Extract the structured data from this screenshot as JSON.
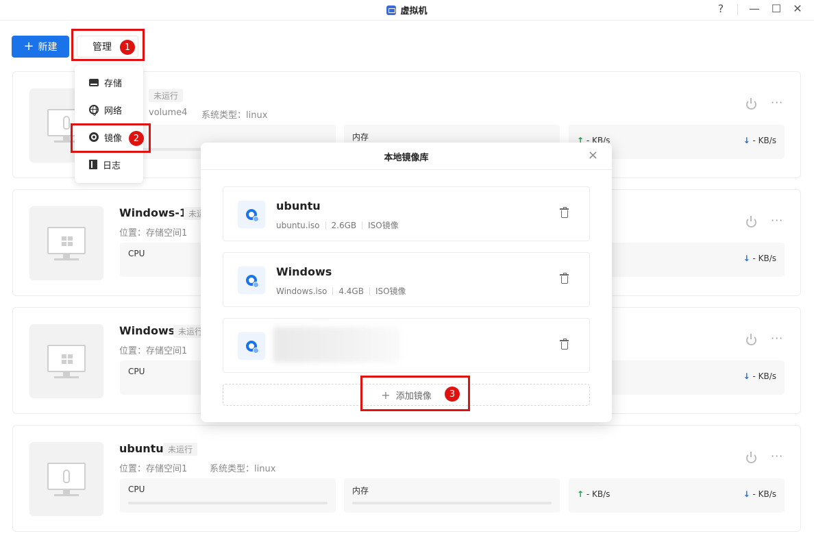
{
  "window": {
    "title": "虚拟机",
    "help": "?",
    "minimize": "—",
    "maximize": "☐",
    "close": "✕"
  },
  "toolbar": {
    "new_label": "新建",
    "manage_label": "管理"
  },
  "annotations": [
    "1",
    "2",
    "3"
  ],
  "manage_menu": {
    "items": [
      {
        "label": "存储",
        "icon": "storage-icon"
      },
      {
        "label": "网络",
        "icon": "globe-icon"
      },
      {
        "label": "镜像",
        "icon": "disc-icon"
      },
      {
        "label": "日志",
        "icon": "log-icon"
      }
    ]
  },
  "vms": [
    {
      "name": "",
      "status": "未运行",
      "location": "volume4",
      "os_type": "系统类型：linux",
      "cpu_label": "",
      "mem_label": "内存",
      "net_up": "- KB/s",
      "net_down": "- KB/s",
      "os": "linux"
    },
    {
      "name": "Windows-1",
      "status": "未运",
      "location": "位置：存储空间1",
      "os_type": "",
      "cpu_label": "CPU",
      "mem_label": "",
      "net_up": "",
      "net_down": "- KB/s",
      "os": "windows"
    },
    {
      "name": "Windows",
      "status": "未运行",
      "location": "位置：存储空间1",
      "os_type": "",
      "cpu_label": "CPU",
      "mem_label": "",
      "net_up": "",
      "net_down": "- KB/s",
      "os": "windows"
    },
    {
      "name": "ubuntu",
      "status": "未运行",
      "location": "位置：存储空间1",
      "os_type": "系统类型：linux",
      "cpu_label": "CPU",
      "mem_label": "内存",
      "net_up": "- KB/s",
      "net_down": "- KB/s",
      "os": "linux"
    }
  ],
  "modal": {
    "title": "本地镜像库",
    "close": "×",
    "images": [
      {
        "name": "ubuntu",
        "file": "ubuntu.iso",
        "size": "2.6GB",
        "kind": "ISO镜像"
      },
      {
        "name": "Windows",
        "file": "Windows.iso",
        "size": "4.4GB",
        "kind": "ISO镜像"
      }
    ],
    "add_label": "添加镜像"
  },
  "colors": {
    "primary": "#1a73e8",
    "annotation_red": "#e0120f",
    "upload_green": "#1ca24a"
  }
}
